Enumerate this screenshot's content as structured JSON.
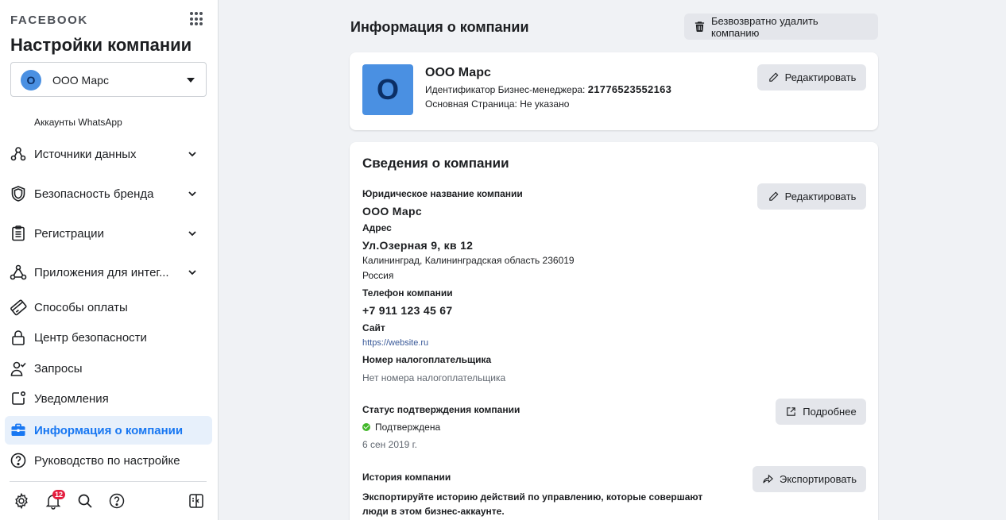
{
  "sidebar": {
    "brand": "FACEBOOK",
    "title": "Настройки компании",
    "account": {
      "initial": "О",
      "name": "ООО Марс"
    },
    "sub_item": "Аккаунты WhatsApp",
    "items": [
      {
        "label": "Источники данных",
        "icon": "data-sources-icon",
        "expandable": true
      },
      {
        "label": "Безопасность бренда",
        "icon": "shield-icon",
        "expandable": true
      },
      {
        "label": "Регистрации",
        "icon": "clipboard-icon",
        "expandable": true
      },
      {
        "label": "Приложения для интег...",
        "icon": "integrations-icon",
        "expandable": true
      },
      {
        "label": "Способы оплаты",
        "icon": "credit-card-icon",
        "expandable": false
      },
      {
        "label": "Центр безопасности",
        "icon": "lock-icon",
        "expandable": false
      },
      {
        "label": "Запросы",
        "icon": "person-check-icon",
        "expandable": false
      },
      {
        "label": "Уведомления",
        "icon": "notification-square-icon",
        "expandable": false
      },
      {
        "label": "Информация о компании",
        "icon": "briefcase-icon",
        "expandable": false,
        "active": true
      },
      {
        "label": "Руководство по настройке",
        "icon": "question-circle-icon",
        "expandable": false
      }
    ],
    "notifications_badge": "12"
  },
  "main": {
    "title": "Информация о компании",
    "delete_button": "Безвозвратно удалить компанию",
    "company_card": {
      "logo_initial": "О",
      "name": "ООО Марс",
      "bm_id_label": "Идентификатор Бизнес-менеджера:",
      "bm_id_value": "21776523552163",
      "primary_page": "Основная Страница: Не указано",
      "edit_button": "Редактировать"
    },
    "details": {
      "title": "Сведения о компании",
      "edit_button": "Редактировать",
      "legal_name_label": "Юридическое название компании",
      "legal_name": "ООО Марс",
      "address_label": "Адрес",
      "address_line1": "Ул.Озерная 9, кв 12",
      "address_line2": "Калининград, Калининградская область 236019",
      "address_line3": "Россия",
      "phone_label": "Телефон компании",
      "phone": "+7 911 123 45 67",
      "site_label": "Сайт",
      "site": "https://website.ru",
      "tax_label": "Номер налогоплательщика",
      "tax_value": "Нет номера налогоплательщика",
      "verification_label": "Статус подтверждения компании",
      "verification_status": "Подтверждена",
      "verification_date": "6 сен 2019 г.",
      "more_button": "Подробнее",
      "history_label": "История компании",
      "history_text_1": "Экспортируйте историю действий по управлению, которые совершают",
      "history_text_2": "люди в этом бизнес-аккаунте.",
      "export_button": "Экспортировать"
    }
  }
}
